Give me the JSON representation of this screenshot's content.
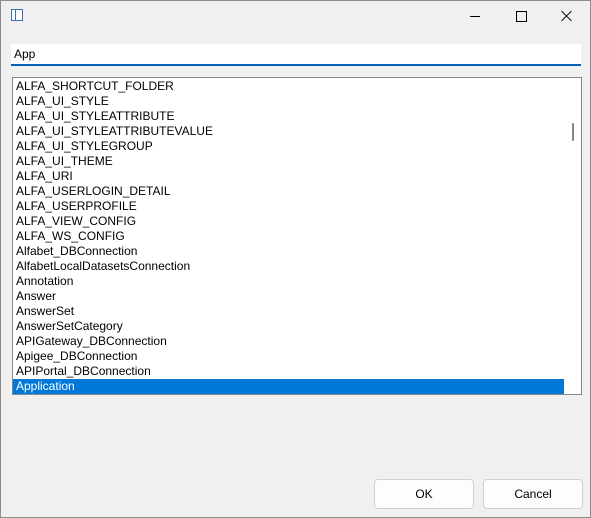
{
  "search": {
    "value": "App"
  },
  "list": {
    "items": [
      "ALFA_SHORTCUT_FOLDER",
      "ALFA_UI_STYLE",
      "ALFA_UI_STYLEATTRIBUTE",
      "ALFA_UI_STYLEATTRIBUTEVALUE",
      "ALFA_UI_STYLEGROUP",
      "ALFA_UI_THEME",
      "ALFA_URI",
      "ALFA_USERLOGIN_DETAIL",
      "ALFA_USERPROFILE",
      "ALFA_VIEW_CONFIG",
      "ALFA_WS_CONFIG",
      "Alfabet_DBConnection",
      "AlfabetLocalDatasetsConnection",
      "Annotation",
      "Answer",
      "AnswerSet",
      "AnswerSetCategory",
      "APIGateway_DBConnection",
      "Apigee_DBConnection",
      "APIPortal_DBConnection",
      "Application"
    ],
    "selected": "Application"
  },
  "buttons": {
    "ok": "OK",
    "cancel": "Cancel"
  },
  "colors": {
    "accent": "#005fb8",
    "selection": "#0078d7"
  }
}
